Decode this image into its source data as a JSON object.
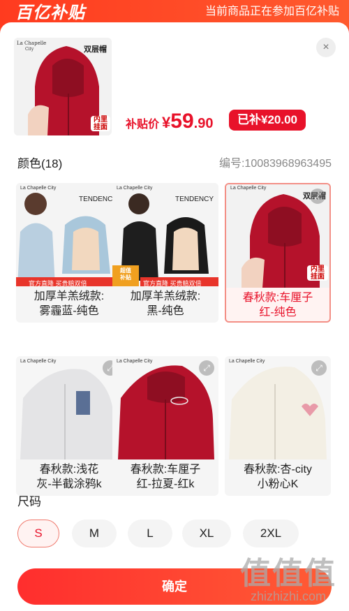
{
  "banner": {
    "logo": "百亿补贴",
    "notice": "当前商品正在参加百亿补贴"
  },
  "product": {
    "hero_tag": "双层帽",
    "hero_inner_tag": "内里\n挂面",
    "brand": "La Chapelle City",
    "price_label": "补贴价",
    "currency": "¥",
    "price_int": "59",
    "price_dec": ".90",
    "subsidy": "已补¥20.00",
    "close": "×"
  },
  "colors": {
    "title": "颜色(18)",
    "code": "编号:10083968963495",
    "items": [
      {
        "label": "加厚羊羔绒款:\n雾霾蓝-纯色",
        "brand": "La Chapelle City",
        "tag": "TENDENCY",
        "promo": "官方直降  买贵赔双倍",
        "selected": false
      },
      {
        "label": "加厚羊羔绒款:\n黑-纯色",
        "brand": "La Chapelle City",
        "tag": "TENDENCY",
        "promo": "官方直降  买贵赔双倍",
        "badge": "超值\n补贴",
        "selected": false
      },
      {
        "label": "春秋款:车厘子\n红-纯色",
        "brand": "La Chapelle City",
        "tag": "双层帽",
        "inner": "内里\n挂面",
        "selected": true
      },
      {
        "label": "春秋款:浅花\n灰-半截涂鸦k",
        "brand": "La Chapelle City",
        "selected": false
      },
      {
        "label": "春秋款:车厘子\n红-拉夏-红k",
        "brand": "La Chapelle City",
        "selected": false
      },
      {
        "label": "春秋款:杏-city\n小粉心K",
        "brand": "La Chapelle City",
        "selected": false
      }
    ]
  },
  "sizes": {
    "title": "尺码",
    "options": [
      "S",
      "M",
      "L",
      "XL",
      "2XL"
    ],
    "selected": "S"
  },
  "confirm_label": "确定",
  "watermark": {
    "logo": "值值值",
    "url": "zhizhizhi.com"
  },
  "palette": {
    "accent": "#e8122a",
    "red_hoodie": "#b5122b",
    "gray_hoodie": "#e4e4e6",
    "cream_hoodie": "#f3efe4"
  }
}
